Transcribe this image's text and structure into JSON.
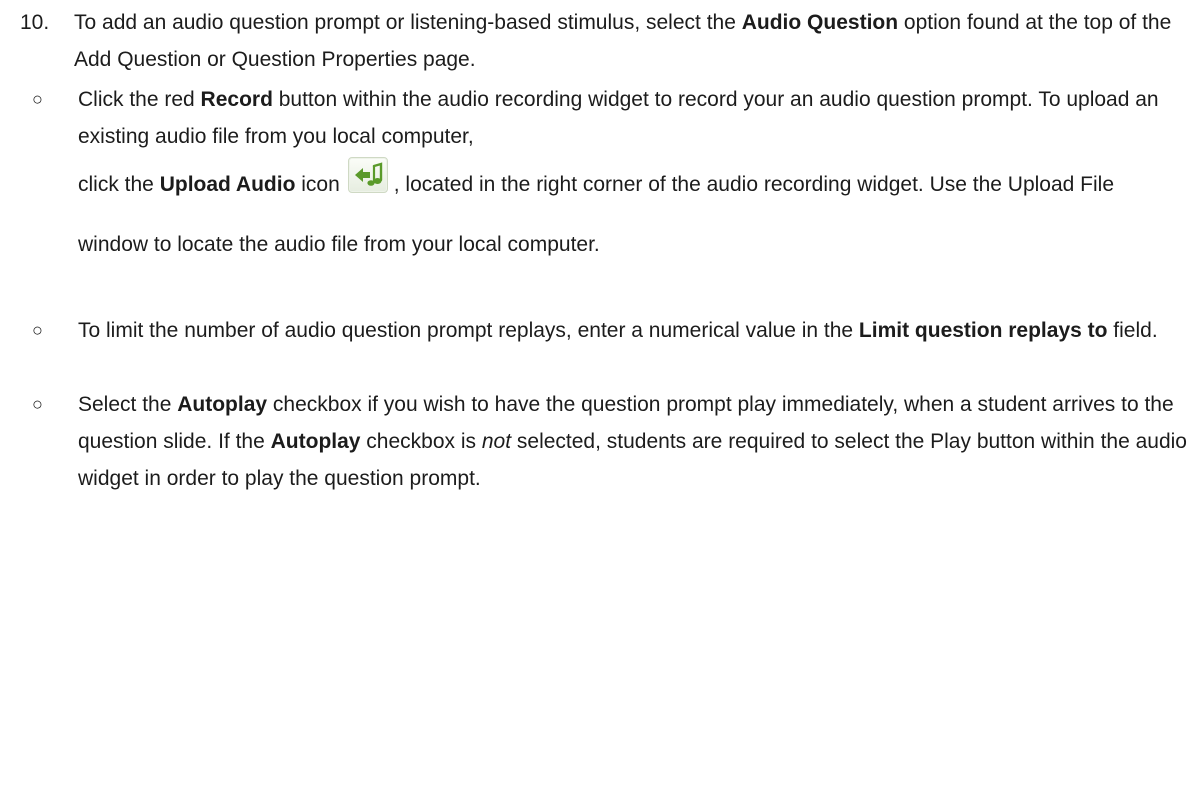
{
  "step": {
    "number": "10.",
    "text_1": "To add an audio question prompt or listening-based stimulus, select the ",
    "bold_1": "Audio Question",
    "text_2": " option found at the top of the Add Question or Question Properties page."
  },
  "bullets": {
    "mark": "○",
    "b1": {
      "t1": "Click the red ",
      "bold1": "Record",
      "t2": " button within the audio recording widget to record your an audio question prompt. To upload an existing audio file from you local computer,",
      "t3": "click the ",
      "bold2": "Upload Audio",
      "t4": " icon",
      "t5": ", located in the right corner of the audio recording widget. Use the Upload File window to locate the audio file from your local computer.",
      "icon": "upload-audio-icon"
    },
    "b2": {
      "t1": "To limit the number of audio question prompt replays, enter a numerical value in the ",
      "bold1": "Limit question replays to",
      "t2": " field."
    },
    "b3": {
      "t1": "Select the ",
      "bold1": "Autoplay",
      "t2": " checkbox if you wish to have the question prompt play immediately, when a student arrives to the question slide. If the ",
      "bold2": "Autoplay",
      "t3": " checkbox is ",
      "italic1": "not",
      "t4": " selected, students are required to select the Play  button within the audio widget in order to play the question prompt."
    }
  },
  "colors": {
    "text": "#1c1c1c",
    "icon_green": "#5a9a2a",
    "icon_bg": "#eef3e9"
  }
}
